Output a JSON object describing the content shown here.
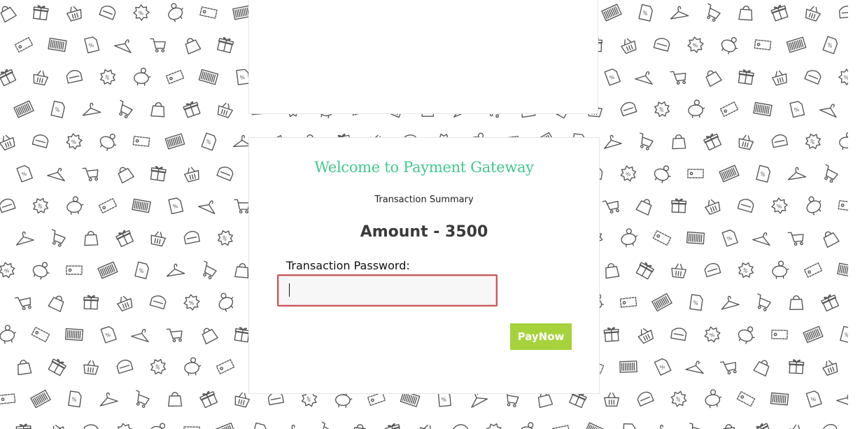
{
  "background": {
    "pattern_icons": [
      "shopping-bag-icon",
      "price-tag-icon",
      "piggy-bank-icon",
      "shopping-basket-icon",
      "shopping-cart-icon",
      "barcode-icon",
      "discount-badge-icon",
      "gift-box-icon",
      "hanger-icon",
      "coupon-icon",
      "wallet-icon"
    ],
    "pattern_color": "#555555"
  },
  "card": {
    "title": "Welcome to Payment Gateway",
    "subtitle": "Transaction Summary",
    "amount_label": "Amount - 3500",
    "password_label": "Transaction Password:",
    "password_value": "",
    "password_placeholder": "",
    "pay_button_label": "PayNow"
  },
  "colors": {
    "title": "#41c98e",
    "button": "#a6d33c",
    "input_border_focus": "#c9575b"
  }
}
